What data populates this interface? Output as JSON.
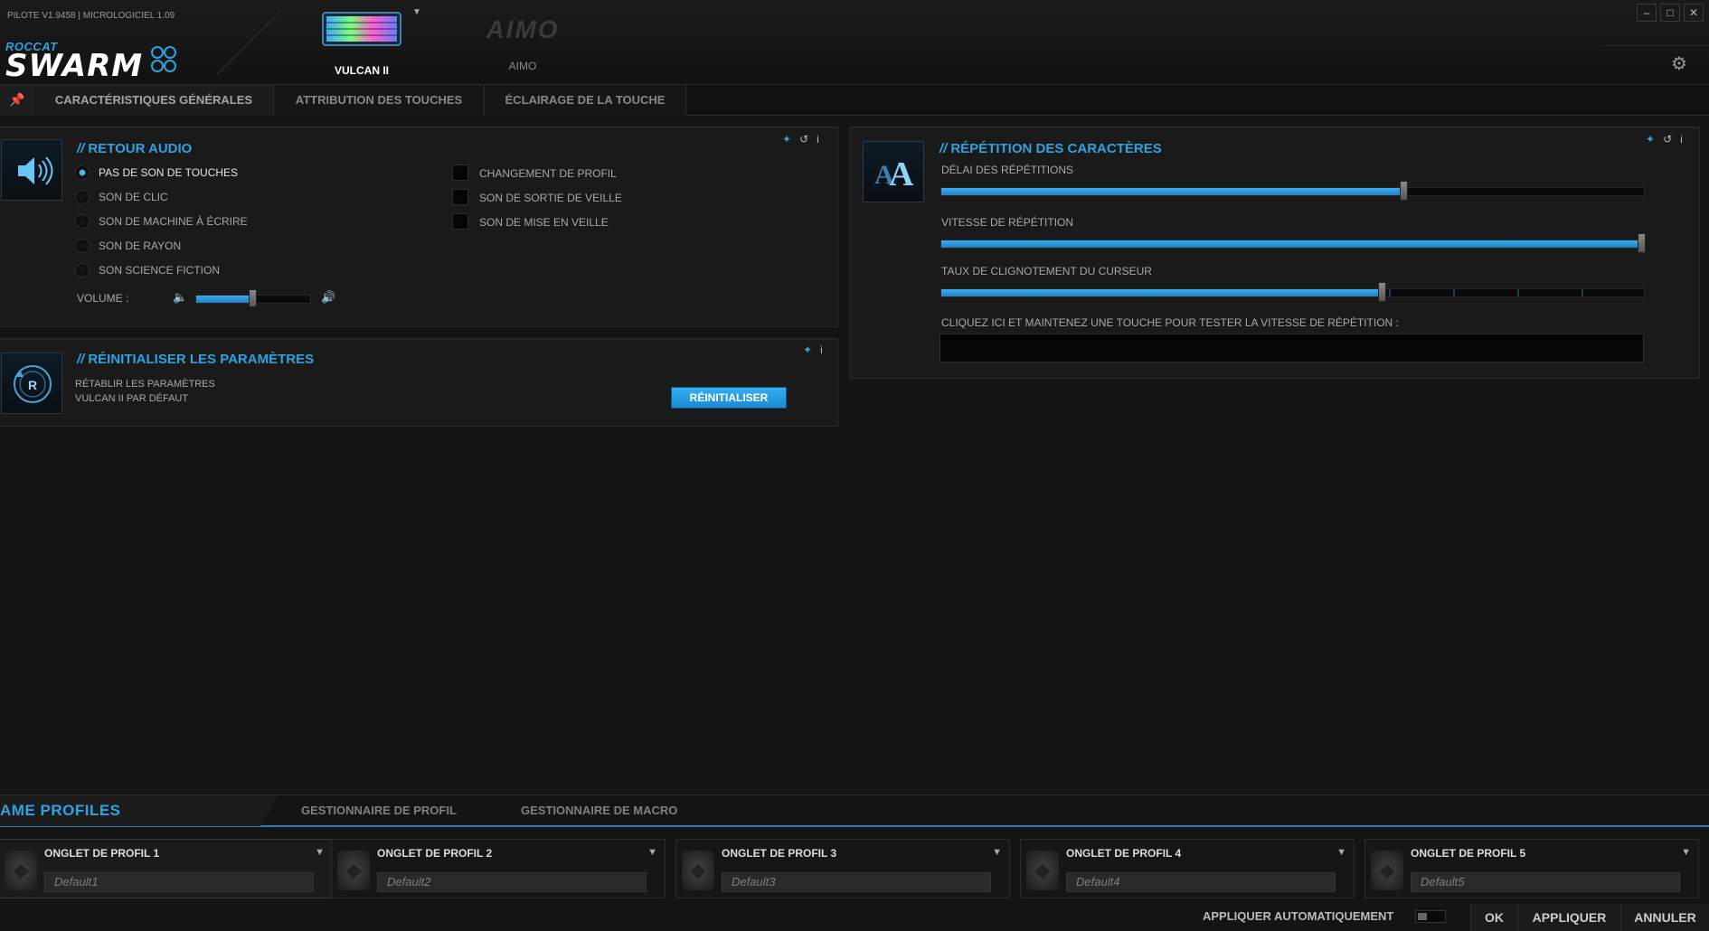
{
  "header": {
    "version": "PILOTE V1.9458 | MICROLOGICIEL 1.09",
    "brand": "ROCCAT",
    "app_name": "SWARM",
    "devices": [
      {
        "name": "VULCAN II",
        "selected": true
      },
      {
        "name": "AIMO",
        "logo_text": "AIMO",
        "selected": false
      }
    ],
    "window_controls": [
      "minimize",
      "maximize",
      "close"
    ]
  },
  "tabs": [
    {
      "label": "CARACTÉRISTIQUES GÉNÉRALES",
      "active": true
    },
    {
      "label": "ATTRIBUTION DES TOUCHES",
      "active": false
    },
    {
      "label": "ÉCLAIRAGE DE LA TOUCHE",
      "active": false
    }
  ],
  "audio": {
    "title": "RETOUR AUDIO",
    "radios": [
      {
        "label": "PAS DE SON DE TOUCHES",
        "selected": true
      },
      {
        "label": "SON DE CLIC",
        "selected": false
      },
      {
        "label": "SON DE MACHINE À ÉCRIRE",
        "selected": false
      },
      {
        "label": "SON DE RAYON",
        "selected": false
      },
      {
        "label": "SON SCIENCE FICTION",
        "selected": false
      }
    ],
    "checkboxes": [
      {
        "label": "CHANGEMENT DE PROFIL",
        "checked": false
      },
      {
        "label": "SON DE SORTIE DE VEILLE",
        "checked": false
      },
      {
        "label": "SON DE MISE EN VEILLE",
        "checked": false
      }
    ],
    "volume_label": "VOLUME :",
    "volume_level": 0.5
  },
  "reset": {
    "title": "RÉINITIALISER LES PARAMÈTRES",
    "desc_line1": "RÉTABLIR LES PARAMÈTRES",
    "desc_line2": "VULCAN II PAR DÉFAUT",
    "button": "RÉINITIALISER"
  },
  "repeat": {
    "title": "RÉPÉTITION DES CARACTÈRES",
    "sliders": [
      {
        "label": "DÉLAI DES RÉPÉTITIONS",
        "level": 0.66
      },
      {
        "label": "VITESSE DE RÉPÉTITION",
        "level": 1.0
      },
      {
        "label": "TAUX DE CLIGNOTEMENT DU CURSEUR",
        "level": 0.63
      }
    ],
    "test_label": "CLIQUEZ ICI ET MAINTENEZ UNE TOUCHE POUR TESTER LA VITESSE DE RÉPÉTITION :",
    "test_value": ""
  },
  "bottom": {
    "tabs": [
      "AME PROFILES",
      "GESTIONNAIRE DE PROFIL",
      "GESTIONNAIRE DE MACRO"
    ],
    "profiles": [
      {
        "tab": "ONGLET DE PROFIL 1",
        "name": "Default1",
        "active": true
      },
      {
        "tab": "ONGLET DE PROFIL 2",
        "name": "Default2",
        "active": false
      },
      {
        "tab": "ONGLET DE PROFIL 3",
        "name": "Default3",
        "active": false
      },
      {
        "tab": "ONGLET DE PROFIL 4",
        "name": "Default4",
        "active": false
      },
      {
        "tab": "ONGLET DE PROFIL 5",
        "name": "Default5",
        "active": false
      }
    ],
    "auto_apply": "APPLIQUER AUTOMATIQUEMENT",
    "auto_apply_on": false,
    "ok": "OK",
    "apply": "APPLIQUER",
    "cancel": "ANNULER"
  },
  "colors": {
    "accent": "#2ea3e0",
    "background": "#141414",
    "panel": "#1a1a1a"
  }
}
